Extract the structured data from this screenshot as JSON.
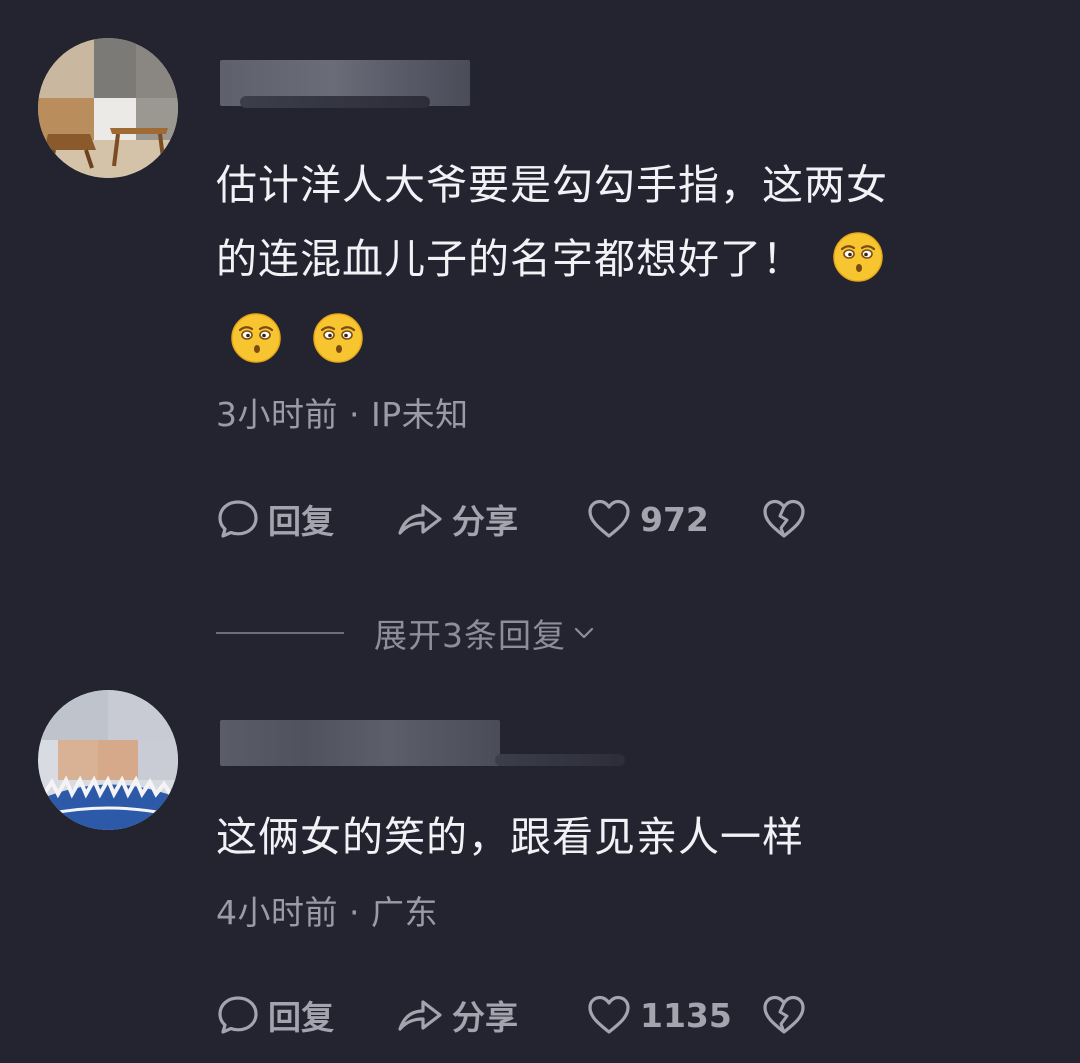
{
  "comments": [
    {
      "text_lines": [
        "估计洋人大爷要是勾勾手指，这两女",
        "的连混血儿子的名字都想好了！"
      ],
      "emoji": "smirk-emoji",
      "meta": "3小时前 · IP未知",
      "actions": {
        "reply_label": "回复",
        "share_label": "分享",
        "like_count": "972"
      },
      "expand_replies_label": "展开3条回复"
    },
    {
      "text_lines": [
        "这俩女的笑的，跟看见亲人一样"
      ],
      "meta": "4小时前 · 广东",
      "actions": {
        "reply_label": "回复",
        "share_label": "分享",
        "like_count": "1135"
      }
    }
  ],
  "colors": {
    "background": "#232430",
    "text": "#f2f2f6",
    "meta": "#9a9ba6",
    "action": "#a3a4ae"
  },
  "icons": [
    "comment-bubble-icon",
    "share-arrow-icon",
    "heart-icon",
    "broken-heart-icon",
    "chevron-down-icon"
  ]
}
